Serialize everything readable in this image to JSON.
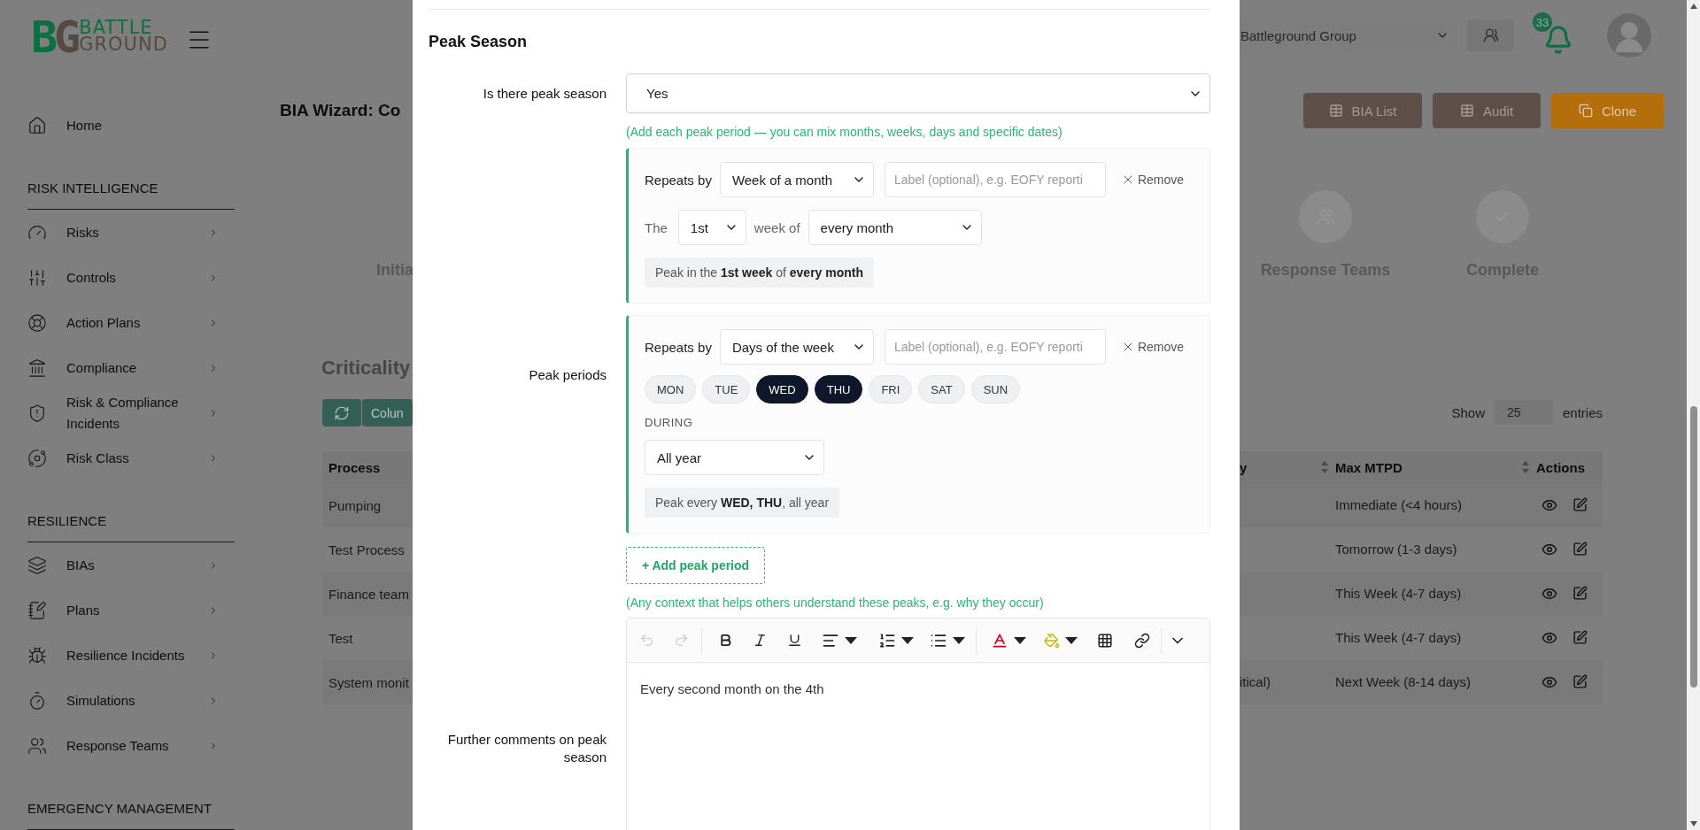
{
  "sidebar": {
    "logo": {
      "mark": [
        "B",
        "G"
      ],
      "words": [
        "BATTLE",
        "GROUND"
      ]
    },
    "home": "Home",
    "sections": [
      {
        "title": "RISK INTELLIGENCE",
        "items": [
          "Risks",
          "Controls",
          "Action Plans",
          "Compliance",
          "Risk & Compliance Incidents",
          "Risk Class"
        ]
      },
      {
        "title": "RESILIENCE",
        "items": [
          "BIAs",
          "Plans",
          "Resilience Incidents",
          "Simulations",
          "Response Teams"
        ]
      },
      {
        "title": "EMERGENCY MANAGEMENT"
      }
    ]
  },
  "header": {
    "organization": "Battleground Group",
    "notifications": "33"
  },
  "page": {
    "title": "BIA Wizard: Co",
    "actions": [
      {
        "label": "BIA List",
        "kind": "list"
      },
      {
        "label": "Audit",
        "kind": "list"
      },
      {
        "label": "Clone",
        "kind": "clone"
      }
    ]
  },
  "wizard": {
    "left_step": "Initia",
    "steps": [
      {
        "label": "Response Teams"
      },
      {
        "label": "Complete"
      }
    ]
  },
  "criticality": {
    "title": "Criticality",
    "columns_button": "Colun",
    "show_label": "Show",
    "page_size": "25",
    "entries_label": "entries",
    "columns": [
      "Process",
      "y",
      "Max MTPD",
      "Actions"
    ],
    "rows": [
      {
        "process": "Pumping",
        "max_mtpd": "Immediate (<4 hours)"
      },
      {
        "process": "Test Process",
        "max_mtpd": "Tomorrow (1-3 days)"
      },
      {
        "process": "Finance team",
        "max_mtpd": "This Week (4-7 days)"
      },
      {
        "process": "Test",
        "max_mtpd": "This Week (4-7 days)"
      },
      {
        "process": "System monit",
        "column_2": "itical)",
        "max_mtpd": "Next Week (8-14 days)"
      }
    ]
  },
  "modal": {
    "title": "Peak Season",
    "peak_question": {
      "label": "Is there peak season",
      "value": "Yes"
    },
    "periods_hint": "(Add each peak period — you can mix months, weeks, days and specific dates)",
    "periods_label": "Peak periods",
    "periods": [
      {
        "kind": "week",
        "repeats_label": "Repeats by",
        "repeats": "Week of a month",
        "label_placeholder": "Label (optional), e.g. EOFY reporti",
        "remove": "Remove",
        "prefix": "The",
        "ordinal": "1st",
        "connector": "week of",
        "month": "every month",
        "summary": "Peak in the **1st week** of **every month**"
      },
      {
        "kind": "days",
        "repeats_label": "Repeats by",
        "repeats": "Days of the week",
        "label_placeholder": "Label (optional), e.g. EOFY reporti",
        "remove": "Remove",
        "days": [
          {
            "label": "MON",
            "selected": false
          },
          {
            "label": "TUE",
            "selected": false
          },
          {
            "label": "WED",
            "selected": true
          },
          {
            "label": "THU",
            "selected": true
          },
          {
            "label": "FRI",
            "selected": false
          },
          {
            "label": "SAT",
            "selected": false
          },
          {
            "label": "SUN",
            "selected": false
          }
        ],
        "during_label": "DURING",
        "during": "All year",
        "summary": "Peak every **WED, THU**, all year"
      }
    ],
    "add_period": "+ Add peak period",
    "comments_hint": "(Any context that helps others understand these peaks, e.g. why they occur)",
    "comments": {
      "label": "Further comments on peak season",
      "value": "Every second month on the 4th"
    },
    "history": {
      "can_undo": false,
      "can_redo": false
    }
  }
}
